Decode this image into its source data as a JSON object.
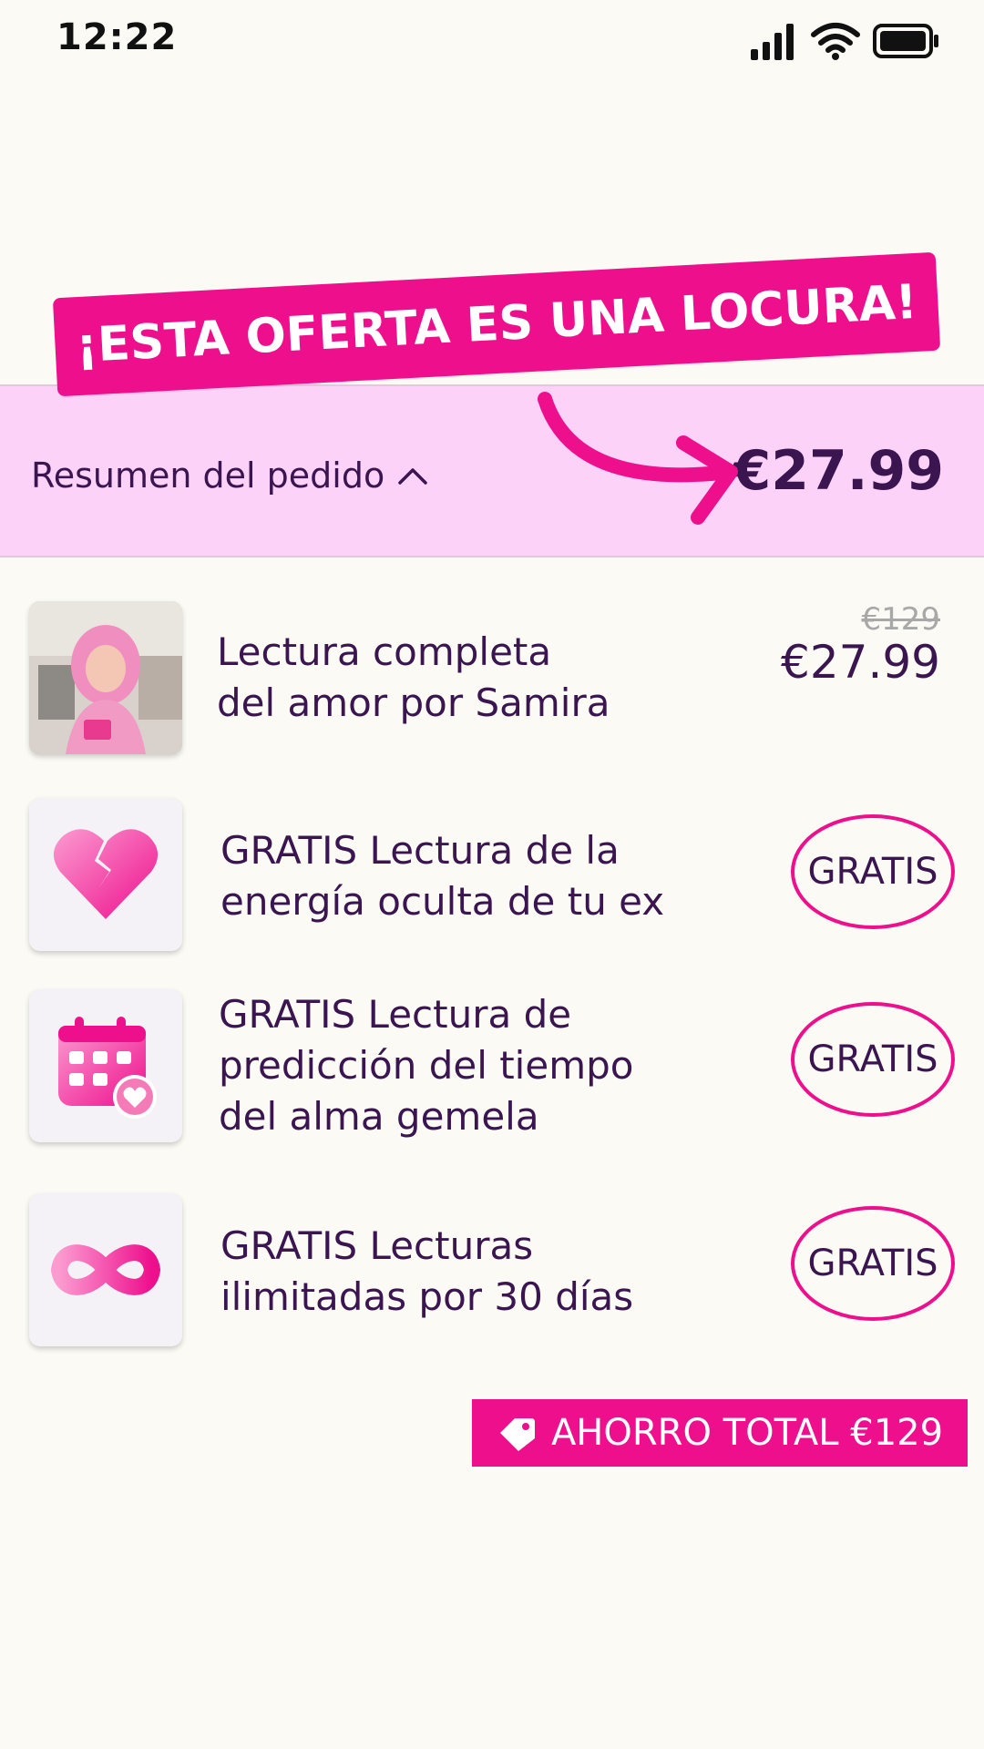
{
  "status_bar": {
    "time": "12:22"
  },
  "banner": {
    "text": "¡ESTA OFERTA ES UNA LOCURA!"
  },
  "summary": {
    "label": "Resumen del pedido",
    "price": "€27.99"
  },
  "items": [
    {
      "title_line1": "Lectura completa",
      "title_line2": "del amor por Samira",
      "old_price": "€129",
      "price": "€27.99",
      "icon": "reader-photo"
    },
    {
      "title_line1": "GRATIS Lectura de la",
      "title_line2": "energía oculta de tu ex",
      "badge": "GRATIS",
      "icon": "broken-heart-icon"
    },
    {
      "title_line1": "GRATIS Lectura de",
      "title_line2": "predicción del tiempo",
      "title_line3": "del alma gemela",
      "badge": "GRATIS",
      "icon": "calendar-heart-icon"
    },
    {
      "title_line1": "GRATIS Lecturas",
      "title_line2": "ilimitadas por 30 días",
      "badge": "GRATIS",
      "icon": "infinity-icon"
    }
  ],
  "savings": {
    "text": "AHORRO TOTAL €129"
  },
  "colors": {
    "accent": "#ee0f8d",
    "summary_bg": "#fdd2f8",
    "text": "#3a1550",
    "background": "#fbfaf4"
  }
}
